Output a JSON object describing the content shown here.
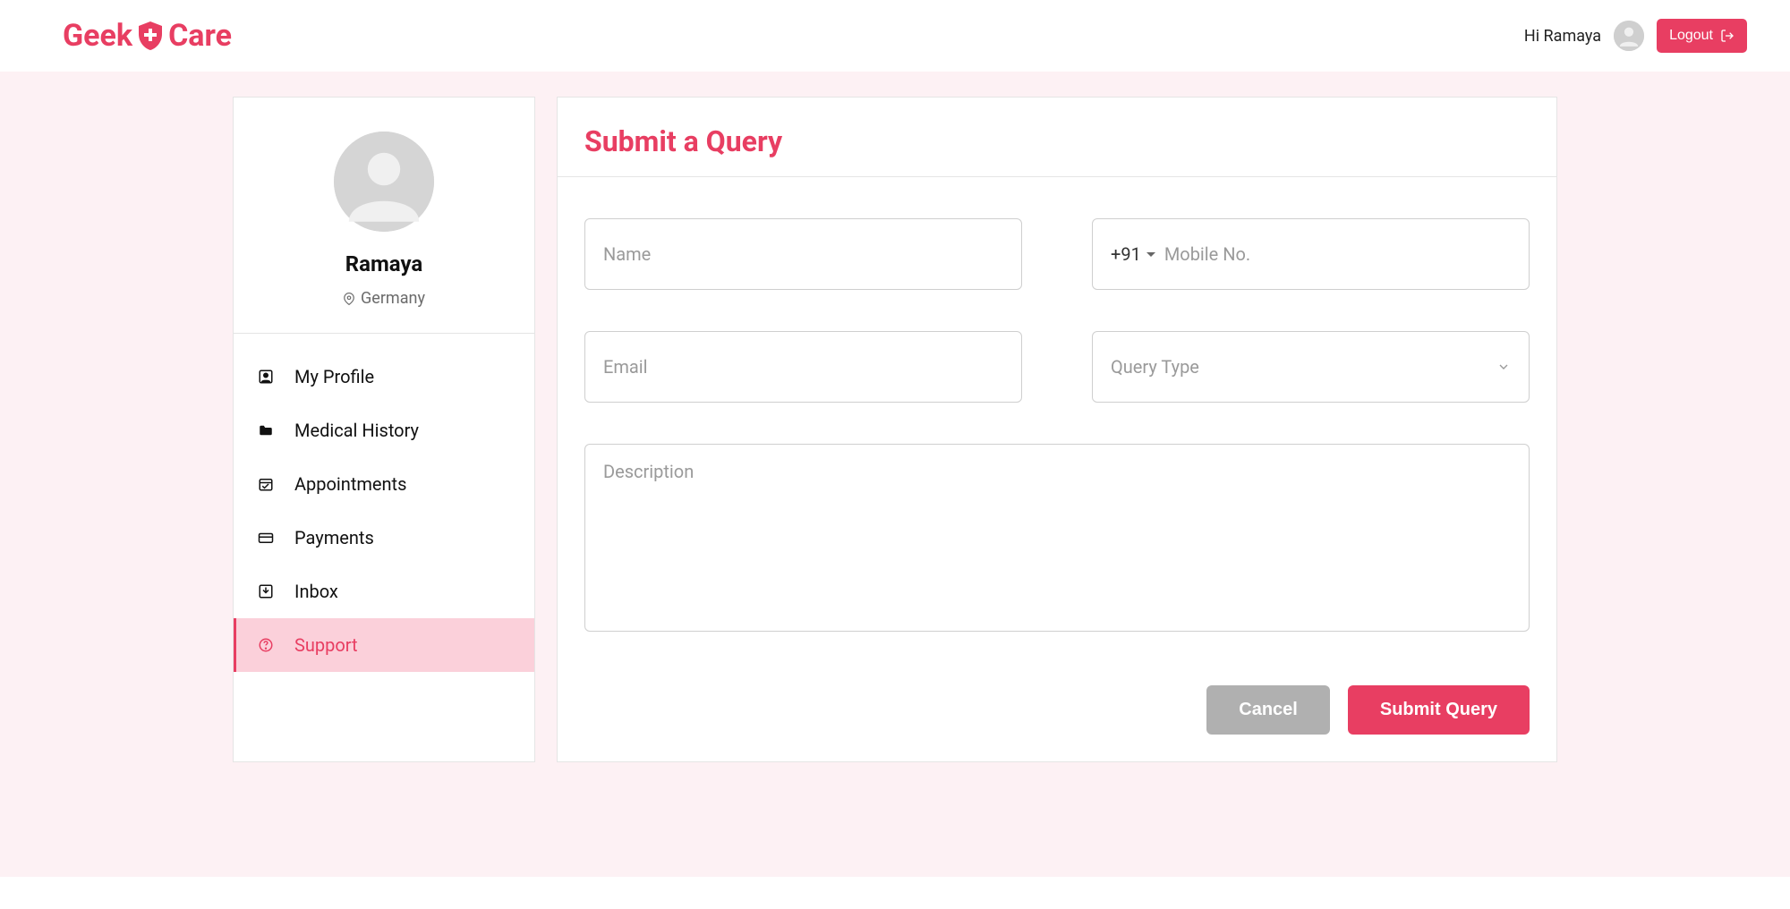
{
  "header": {
    "logo_part1": "Geek",
    "logo_part2": "Care",
    "greeting": "Hi Ramaya",
    "logout_label": "Logout"
  },
  "sidebar": {
    "profile": {
      "name": "Ramaya",
      "location": "Germany"
    },
    "nav": [
      {
        "label": "My Profile",
        "icon": "profile-icon",
        "active": false
      },
      {
        "label": "Medical History",
        "icon": "folder-icon",
        "active": false
      },
      {
        "label": "Appointments",
        "icon": "calendar-icon",
        "active": false
      },
      {
        "label": "Payments",
        "icon": "card-icon",
        "active": false
      },
      {
        "label": "Inbox",
        "icon": "inbox-icon",
        "active": false
      },
      {
        "label": "Support",
        "icon": "help-icon",
        "active": true
      }
    ]
  },
  "main": {
    "title": "Submit a Query",
    "form": {
      "name_placeholder": "Name",
      "country_code": "+91",
      "mobile_placeholder": "Mobile No.",
      "email_placeholder": "Email",
      "query_type_placeholder": "Query Type",
      "description_placeholder": "Description",
      "cancel_label": "Cancel",
      "submit_label": "Submit Query"
    }
  },
  "colors": {
    "accent": "#e83e62",
    "bg_tint": "#fdf1f4",
    "active_nav_bg": "#fbd0da"
  }
}
